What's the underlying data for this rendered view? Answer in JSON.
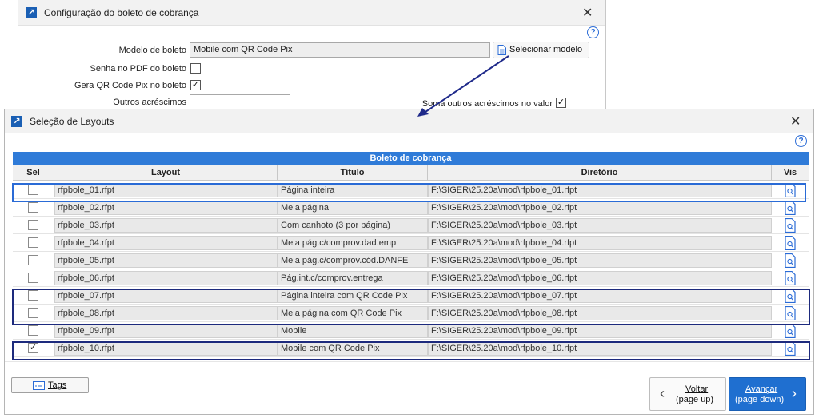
{
  "bg_window": {
    "title": "Configuração do boleto de cobrança",
    "close_symbol": "✕",
    "help_symbol": "?",
    "fields": {
      "modelo_label": "Modelo de boleto",
      "modelo_value": "Mobile com QR Code Pix",
      "selecionar_label": "Selecionar modelo",
      "senha_label": "Senha no PDF do boleto",
      "gera_qr_label": "Gera QR Code Pix no boleto",
      "gera_qr_checked": "✓",
      "outros_label": "Outros acréscimos",
      "outros_value": "",
      "soma_label": "Soma outros acréscimos no valor",
      "soma_checked": "✓"
    }
  },
  "fg_window": {
    "title": "Seleção de Layouts",
    "close_symbol": "✕",
    "help_symbol": "?",
    "grid": {
      "caption": "Boleto de cobrança",
      "headers": {
        "sel": "Sel",
        "layout": "Layout",
        "titulo": "Título",
        "diretorio": "Diretório",
        "vis": "Vis"
      },
      "rows": [
        {
          "layout": "rfpbole_01.rfpt",
          "titulo": "Página inteira",
          "diretorio": "F:\\SIGER\\25.20a\\mod\\rfpbole_01.rfpt",
          "checked": ""
        },
        {
          "layout": "rfpbole_02.rfpt",
          "titulo": "Meia página",
          "diretorio": "F:\\SIGER\\25.20a\\mod\\rfpbole_02.rfpt",
          "checked": ""
        },
        {
          "layout": "rfpbole_03.rfpt",
          "titulo": "Com canhoto (3 por página)",
          "diretorio": "F:\\SIGER\\25.20a\\mod\\rfpbole_03.rfpt",
          "checked": ""
        },
        {
          "layout": "rfpbole_04.rfpt",
          "titulo": "Meia pág.c/comprov.dad.emp",
          "diretorio": "F:\\SIGER\\25.20a\\mod\\rfpbole_04.rfpt",
          "checked": ""
        },
        {
          "layout": "rfpbole_05.rfpt",
          "titulo": "Meia pág.c/comprov.cód.DANFE",
          "diretorio": "F:\\SIGER\\25.20a\\mod\\rfpbole_05.rfpt",
          "checked": ""
        },
        {
          "layout": "rfpbole_06.rfpt",
          "titulo": "Pág.int.c/comprov.entrega",
          "diretorio": "F:\\SIGER\\25.20a\\mod\\rfpbole_06.rfpt",
          "checked": ""
        },
        {
          "layout": "rfpbole_07.rfpt",
          "titulo": "Página inteira com QR Code Pix",
          "diretorio": "F:\\SIGER\\25.20a\\mod\\rfpbole_07.rfpt",
          "checked": ""
        },
        {
          "layout": "rfpbole_08.rfpt",
          "titulo": "Meia página com QR Code Pix",
          "diretorio": "F:\\SIGER\\25.20a\\mod\\rfpbole_08.rfpt",
          "checked": ""
        },
        {
          "layout": "rfpbole_09.rfpt",
          "titulo": "Mobile",
          "diretorio": "F:\\SIGER\\25.20a\\mod\\rfpbole_09.rfpt",
          "checked": ""
        },
        {
          "layout": "rfpbole_10.rfpt",
          "titulo": "Mobile com QR Code Pix",
          "diretorio": "F:\\SIGER\\25.20a\\mod\\rfpbole_10.rfpt",
          "checked": "✓"
        }
      ]
    },
    "footer": {
      "tags_label": "Tags",
      "voltar_label": "Voltar",
      "voltar_sub": "(page up)",
      "avancar_label": "Avançar",
      "avancar_sub": "(page down)"
    }
  },
  "colors": {
    "accent": "#2f7bd8",
    "highlight_border": "#1d2a7d",
    "arrow": "#1f2a8a"
  },
  "icons": {
    "app": "app-arrow-icon",
    "document": "document-icon",
    "preview": "preview-doc-icon",
    "tags": "tags-icon",
    "chevron_left": "chevron-left-icon",
    "chevron_right": "chevron-right-icon"
  }
}
